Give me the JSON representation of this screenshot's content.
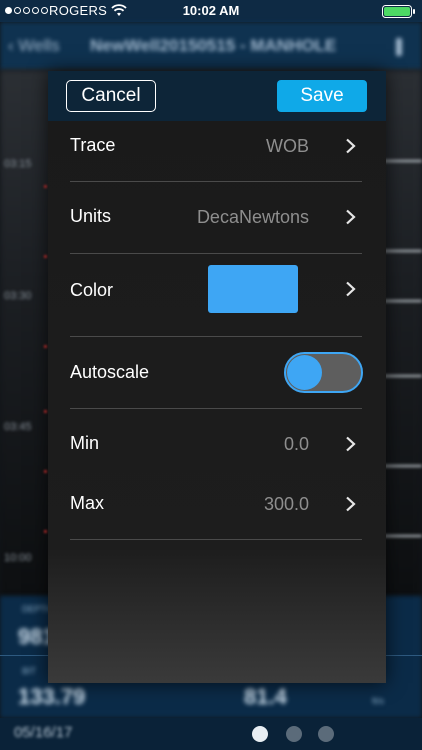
{
  "status_bar": {
    "carrier": "ROGERS",
    "time": "10:02 AM"
  },
  "background": {
    "back_label": "Wells",
    "title": "NewWell20150515 - MANHOLE",
    "depth_labels": [
      "03:15",
      "03:30",
      "03:45",
      "10:00"
    ],
    "readouts": [
      {
        "label": "DEPTH",
        "value": "981"
      },
      {
        "label": "BIT",
        "value": "133.79"
      },
      {
        "label": "ft/s",
        "value": "81.4"
      }
    ],
    "date": "05/16/17"
  },
  "dialog": {
    "cancel_label": "Cancel",
    "save_label": "Save",
    "rows": {
      "trace": {
        "label": "Trace",
        "value": "WOB"
      },
      "units": {
        "label": "Units",
        "value": "DecaNewtons"
      },
      "color": {
        "label": "Color",
        "swatch": "#3ea6f4"
      },
      "autoscale": {
        "label": "Autoscale",
        "enabled": true
      },
      "min": {
        "label": "Min",
        "value": "0.0"
      },
      "max": {
        "label": "Max",
        "value": "300.0"
      }
    }
  },
  "icons": {
    "chevron": "chevron-right-icon",
    "wifi": "wifi-icon",
    "battery": "battery-icon"
  },
  "colors": {
    "accent": "#0fa9e8",
    "header": "#0d2538",
    "toggle_on": "#3ea6f4",
    "battery": "#4cd964"
  }
}
